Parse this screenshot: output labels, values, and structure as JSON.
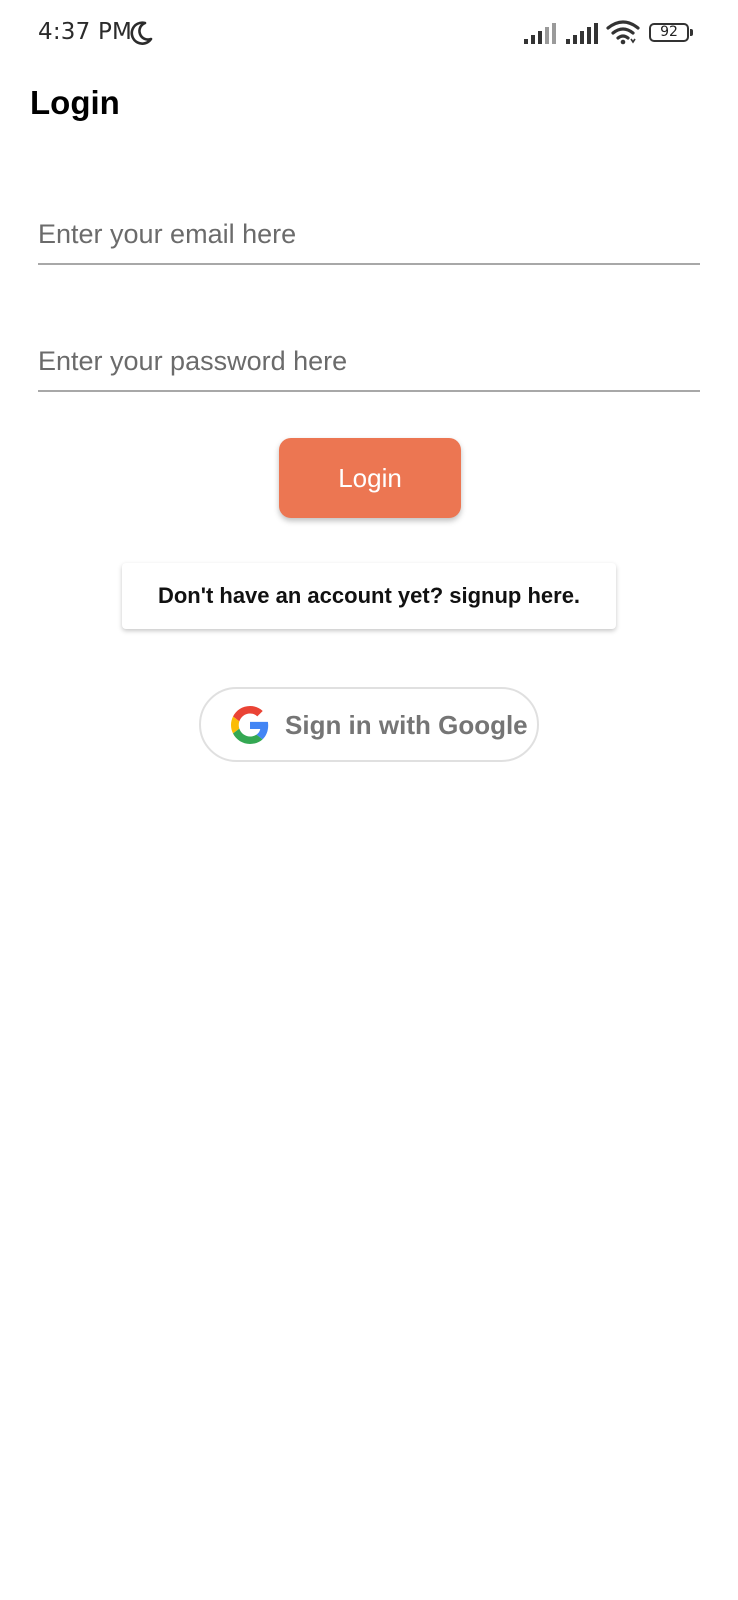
{
  "status_bar": {
    "time": "4:37 PM",
    "battery_level": "92",
    "icons": [
      "moon-icon",
      "signal-icon",
      "signal-icon",
      "wifi-icon",
      "battery-icon"
    ]
  },
  "page": {
    "title": "Login"
  },
  "form": {
    "email_placeholder": "Enter your email here",
    "email_value": "",
    "password_placeholder": "Enter your password here",
    "password_value": "",
    "login_label": "Login",
    "signup_label": "Don't have an account yet? signup here.",
    "google_label": "Sign in with Google"
  },
  "colors": {
    "accent": "#ec7652",
    "background": "#ffffff",
    "underline": "#a8a8a8",
    "google_text": "#757575"
  }
}
